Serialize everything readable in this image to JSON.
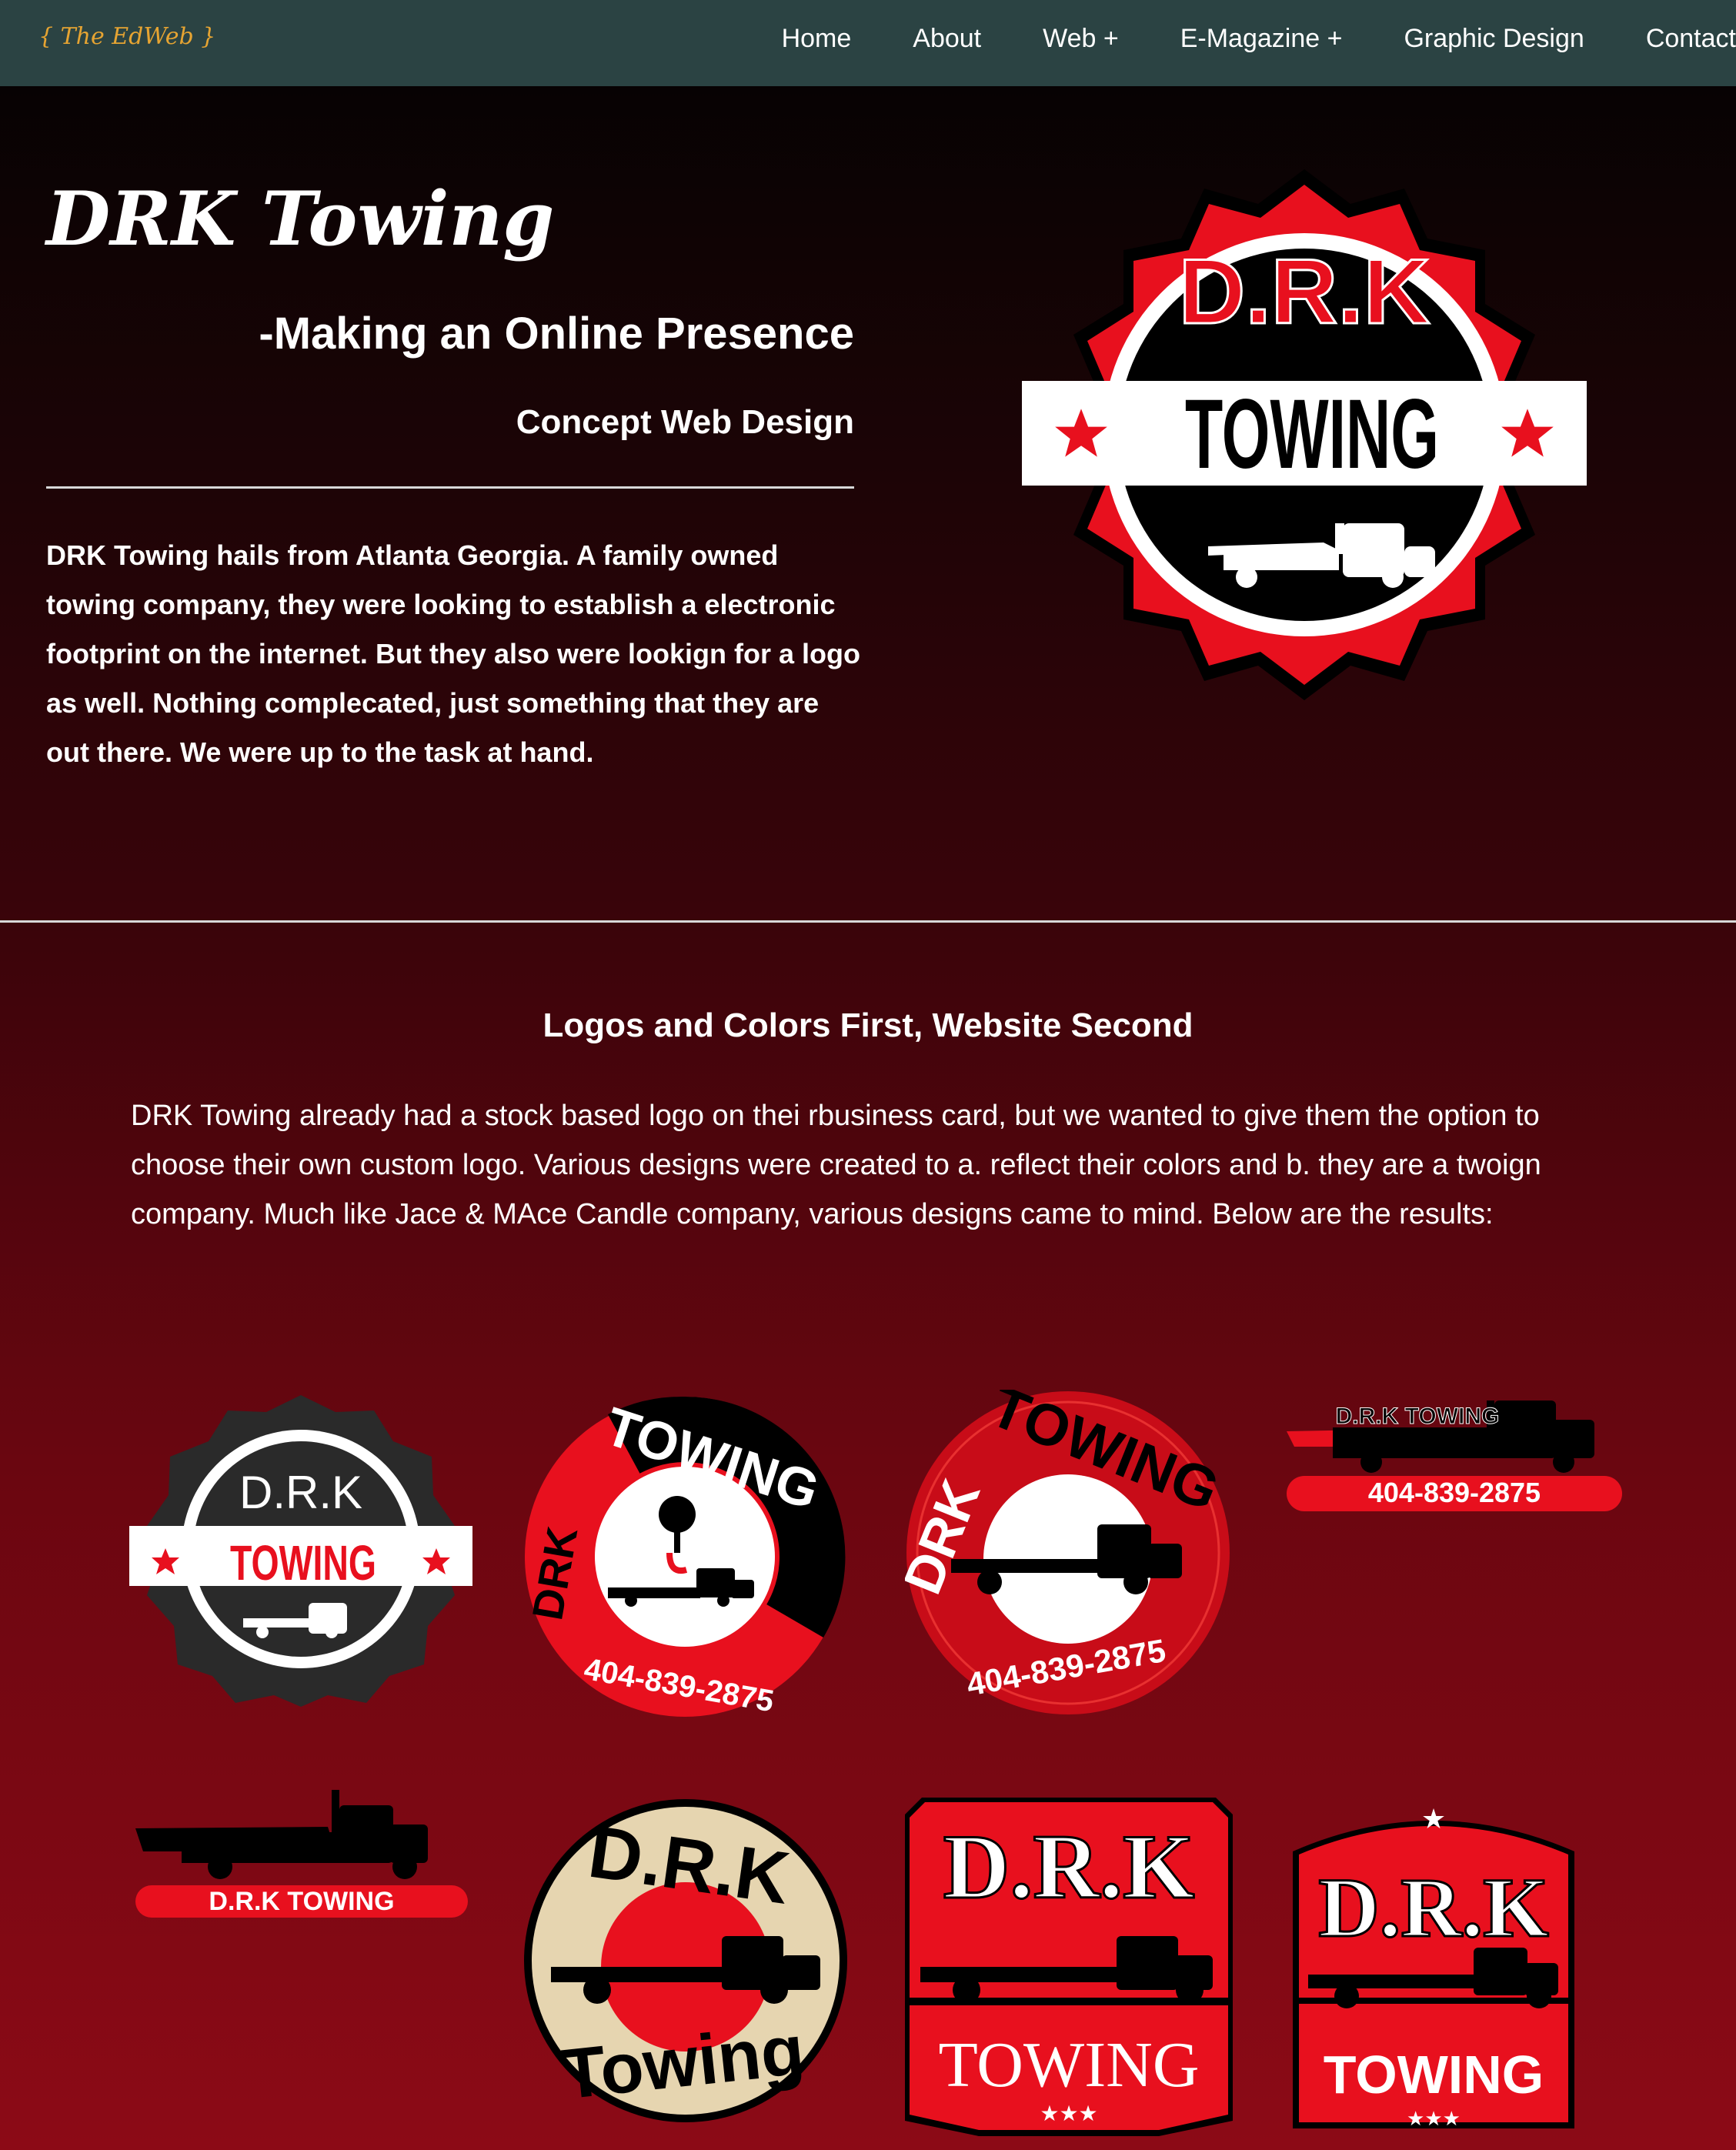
{
  "nav": {
    "brand": "{ The EdWeb }",
    "items": [
      "Home",
      "About",
      "Web +",
      "E-Magazine +",
      "Graphic Design",
      "Contact"
    ]
  },
  "hero": {
    "title": "DRK Towing",
    "subtitle": "-Making an Online Presence",
    "subtitle2": "Concept Web Design",
    "body": "DRK Towing hails from Atlanta Georgia. A family owned towing company, they were looking to establish a electronic footprint on the internet. But they also were lookign for a logo as well. Nothing complecated, just something that they are out there. We were up to the task at hand."
  },
  "section": {
    "title": "Logos and Colors First, Website Second",
    "body": "DRK Towing already had a stock based logo on thei rbusiness card, but we wanted to give them the option to choose their own custom logo. Various designs were created to a. reflect their colors and b. they are a twoign company. Much like Jace & MAce Candle company, various designs came to mind. Below are the results:"
  },
  "logos": {
    "drk": "D.R.K",
    "drk_small": "DRK",
    "towing": "TOWING",
    "towing_script": "Towing",
    "phone": "404-839-2875",
    "drk_towing": "D.R.K TOWING",
    "drk_towing_banner": "D.R.K TOWING"
  },
  "colors": {
    "nav_bg": "#2b4343",
    "brand": "#e6a432",
    "red": "#e8101e",
    "black": "#000000",
    "cream": "#e6d5b0"
  }
}
